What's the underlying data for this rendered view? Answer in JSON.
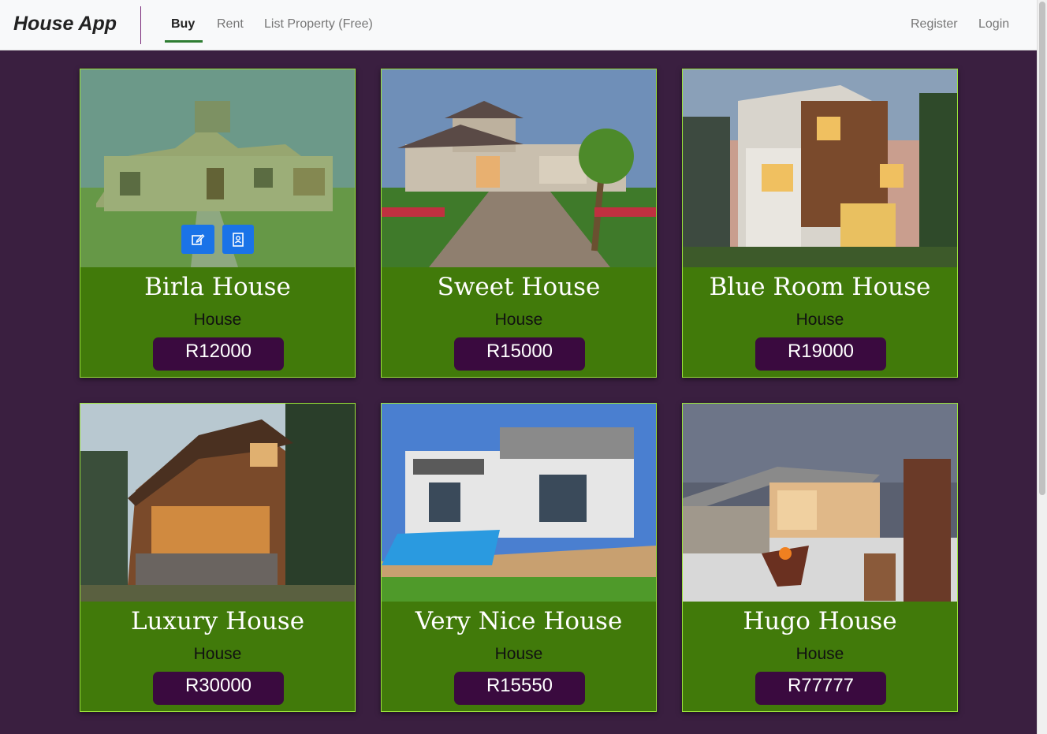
{
  "app": {
    "brand": "House App"
  },
  "nav": {
    "links": [
      {
        "label": "Buy",
        "active": true
      },
      {
        "label": "Rent",
        "active": false
      },
      {
        "label": "List Property (Free)",
        "active": false
      }
    ],
    "auth": [
      {
        "label": "Register"
      },
      {
        "label": "Login"
      }
    ]
  },
  "colors": {
    "background": "#3a1f40",
    "card": "#417a0a",
    "card_border": "#9be53a",
    "price_pill": "#3a0a3f",
    "action_button": "#1a73e8"
  },
  "card_actions": [
    {
      "icon": "edit-icon"
    },
    {
      "icon": "contact-card-icon"
    }
  ],
  "listings": [
    {
      "title": "Birla House",
      "type": "House",
      "price": "R12000"
    },
    {
      "title": "Sweet House",
      "type": "House",
      "price": "R15000"
    },
    {
      "title": "Blue Room House",
      "type": "House",
      "price": "R19000"
    },
    {
      "title": "Luxury House",
      "type": "House",
      "price": "R30000"
    },
    {
      "title": "Very Nice House",
      "type": "House",
      "price": "R15550"
    },
    {
      "title": "Hugo House",
      "type": "House",
      "price": "R77777"
    }
  ]
}
